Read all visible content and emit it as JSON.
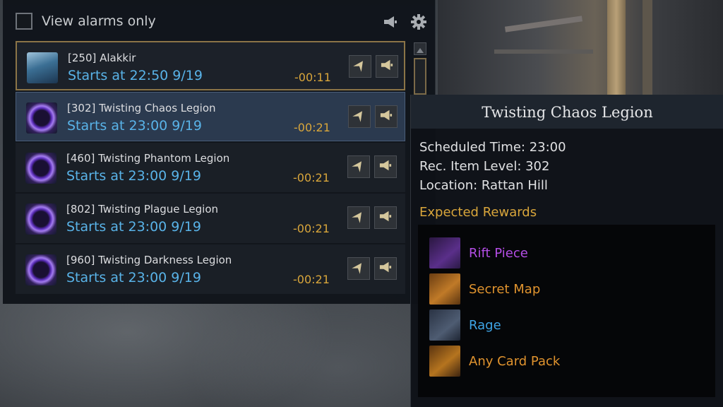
{
  "header": {
    "checkbox_label": "View alarms only",
    "icons": [
      "megaphone-icon",
      "gear-icon"
    ]
  },
  "events": [
    {
      "name": "[250] Alakkir",
      "starts": "Starts at 22:50 9/19",
      "countdown": "-00:11",
      "icon": "alakkir-boss-icon",
      "state": "highlighted"
    },
    {
      "name": "[302] Twisting Chaos Legion",
      "starts": "Starts at 23:00 9/19",
      "countdown": "-00:21",
      "icon": "legion-portal-icon",
      "state": "selected"
    },
    {
      "name": "[460] Twisting Phantom Legion",
      "starts": "Starts at 23:00 9/19",
      "countdown": "-00:21",
      "icon": "legion-portal-icon",
      "state": "normal"
    },
    {
      "name": "[802] Twisting Plague Legion",
      "starts": "Starts at 23:00 9/19",
      "countdown": "-00:21",
      "icon": "legion-portal-icon",
      "state": "normal"
    },
    {
      "name": "[960] Twisting Darkness Legion",
      "starts": "Starts at 23:00 9/19",
      "countdown": "-00:21",
      "icon": "legion-portal-icon",
      "state": "normal"
    }
  ],
  "tooltip": {
    "title": "Twisting Chaos Legion",
    "scheduled": "Scheduled Time: 23:00",
    "item_level": "Rec. Item Level: 302",
    "location": "Location: Rattan Hill",
    "rewards_heading": "Expected Rewards",
    "rewards": [
      {
        "label": "Rift Piece",
        "color": "#b44ee6",
        "icon": "rift-piece-icon"
      },
      {
        "label": "Secret Map",
        "color": "#e0932e",
        "icon": "secret-map-icon"
      },
      {
        "label": "Rage",
        "color": "#3ea4e6",
        "icon": "rage-icon"
      },
      {
        "label": "Any Card Pack",
        "color": "#e0932e",
        "icon": "card-pack-icon"
      }
    ]
  },
  "colors": {
    "accent_gold": "#d9a63b",
    "time_blue": "#59b3e8"
  }
}
